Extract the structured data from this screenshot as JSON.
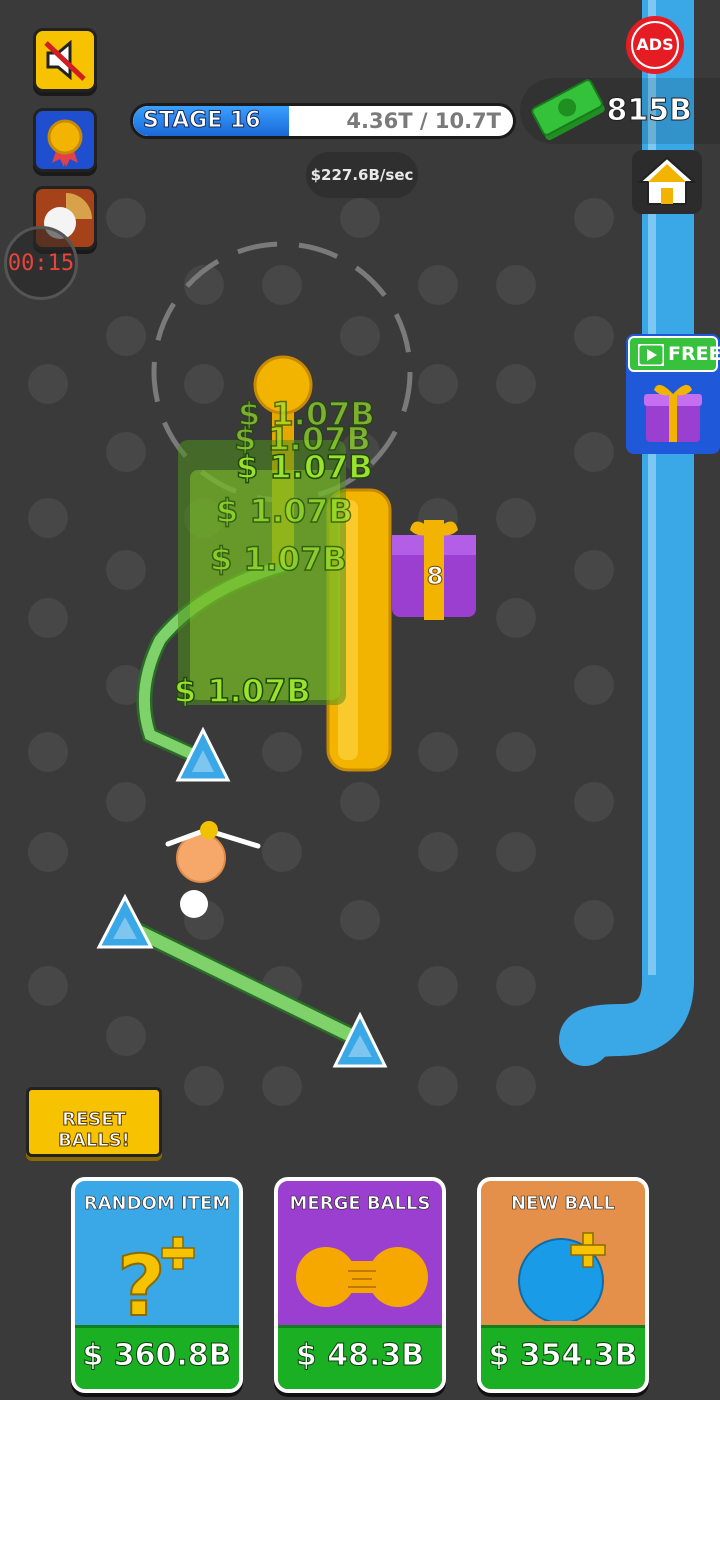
{
  "hud": {
    "stage_label": "STAGE 16",
    "stage_progress_text": "4.36T / 10.7T",
    "stage_progress_fraction": 0.41,
    "earn_rate": "$227.6B/sec",
    "cash": "815B",
    "ads_label": "ADS",
    "timer": "00:15"
  },
  "free_gift": {
    "label": "FREE"
  },
  "playfield": {
    "floating_money_labels": [
      "$ 1.07B",
      "$ 1.07B",
      "$ 1.07B",
      "$ 1.07B",
      "$ 1.07B",
      "$ 1.07B"
    ],
    "gift_box_count": "8"
  },
  "reset_button": {
    "label": "RESET BALLS!"
  },
  "cards": [
    {
      "title": "RANDOM ITEM",
      "price": "$ 360.8B",
      "icon": "question-plus-icon"
    },
    {
      "title": "MERGE BALLS",
      "price": "$ 48.3B",
      "icon": "merge-balls-icon"
    },
    {
      "title": "NEW BALL",
      "price": "$ 354.3B",
      "icon": "ball-plus-icon"
    }
  ],
  "colors": {
    "background": "#3a3a3a",
    "peg": "#4a4a4a",
    "pipe": "#3aa7e6",
    "rail": "#7fd26a",
    "accent_yellow": "#f7c300",
    "money_green": "#1bb024"
  }
}
